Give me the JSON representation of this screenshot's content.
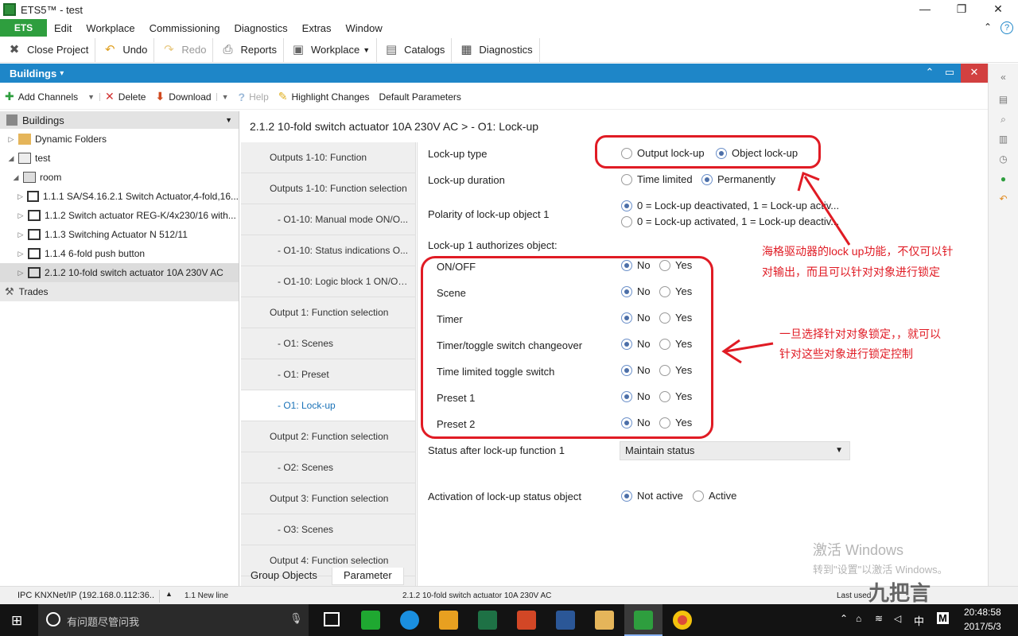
{
  "window": {
    "title": "ETS5™ - test",
    "minimize": "—",
    "maximize": "❐",
    "close": "✕",
    "help": "?",
    "collapse": "⌃"
  },
  "menu": {
    "ets": "ETS",
    "items": [
      "Edit",
      "Workplace",
      "Commissioning",
      "Diagnostics",
      "Extras",
      "Window"
    ]
  },
  "toolbar": {
    "close_project": "Close Project",
    "undo": "Undo",
    "redo": "Redo",
    "reports": "Reports",
    "workplace": "Workplace",
    "catalogs": "Catalogs",
    "diagnostics": "Diagnostics"
  },
  "panel": {
    "title": "Buildings",
    "caret": "▾"
  },
  "actions": {
    "add_channels": "Add Channels",
    "delete": "Delete",
    "download": "Download",
    "help": "Help",
    "highlight": "Highlight Changes",
    "default_params": "Default Parameters"
  },
  "tree": {
    "header": "Buildings",
    "dynamic_folders": "Dynamic Folders",
    "project": "test",
    "room": "room",
    "devices": [
      "1.1.1 SA/S4.16.2.1 Switch Actuator,4-fold,16...",
      "1.1.2 Switch actuator REG-K/4x230/16 with...",
      "1.1.3 Switching Actuator N 512/11",
      "1.1.4 6-fold push button",
      "2.1.2 10-fold switch actuator 10A 230V AC"
    ],
    "trades": "Trades"
  },
  "breadcrumb": "2.1.2 10-fold switch actuator 10A 230V AC >    - O1: Lock-up",
  "nav": [
    "Outputs 1-10: Function",
    "Outputs 1-10: Function selection",
    "- O1-10: Manual mode ON/O...",
    "- O1-10: Status indications O...",
    "- O1-10: Logic block 1 ON/OFF",
    "Output 1: Function selection",
    "- O1: Scenes",
    "- O1: Preset",
    "- O1: Lock-up",
    "Output 2: Function selection",
    "- O2: Scenes",
    "Output 3: Function selection",
    "- O3: Scenes",
    "Output 4: Function selection"
  ],
  "nav_selected": 8,
  "params": {
    "lockup_type": {
      "label": "Lock-up type",
      "opt1": "Output lock-up",
      "opt2": "Object lock-up"
    },
    "lockup_duration": {
      "label": "Lock-up duration",
      "opt1": "Time limited",
      "opt2": "Permanently"
    },
    "polarity": {
      "label": "Polarity of lock-up object 1",
      "opt1": "0 = Lock-up deactivated, 1 = Lock-up activ...",
      "opt2": "0 = Lock-up activated, 1 = Lock-up deactiv..."
    },
    "authorizes": "Lock-up 1 authorizes object:",
    "objects": [
      "ON/OFF",
      "Scene",
      "Timer",
      "Timer/toggle switch changeover",
      "Time limited toggle switch",
      "Preset 1",
      "Preset 2"
    ],
    "no": "No",
    "yes": "Yes",
    "status_after": {
      "label": "Status after lock-up function 1",
      "value": "Maintain status"
    },
    "activation": {
      "label": "Activation of lock-up status object",
      "opt1": "Not active",
      "opt2": "Active"
    }
  },
  "bottom_tabs": {
    "group_objects": "Group Objects",
    "parameter": "Parameter"
  },
  "status": {
    "connection": "IPC KNXNet/IP (192.168.0.112:36...",
    "line": "1.1 New line",
    "device": "2.1.2 10-fold switch actuator 10A 230V AC",
    "last": "Last used"
  },
  "annotations": {
    "note1_line1": "海格驱动器的lock up功能，不仅可以针",
    "note1_line2": "对输出，而且可以针对对象进行锁定",
    "note2_line1": "一旦选择针对对象锁定，，就可以",
    "note2_line2": "针对这些对象进行锁定控制"
  },
  "watermark": {
    "line1": "激活 Windows",
    "line2": "转到\"设置\"以激活 Windows。"
  },
  "logo": "九把言",
  "taskbar": {
    "search": "有问题尽管问我",
    "time": "20:48:58",
    "date": "2017/5/3",
    "ime": "中",
    "ime2": "M"
  },
  "colors": {
    "accent": "#1e86c8",
    "ets_green": "#2e9e3e",
    "annotation": "#e01b24",
    "selected_nav": "#1a72b8"
  }
}
